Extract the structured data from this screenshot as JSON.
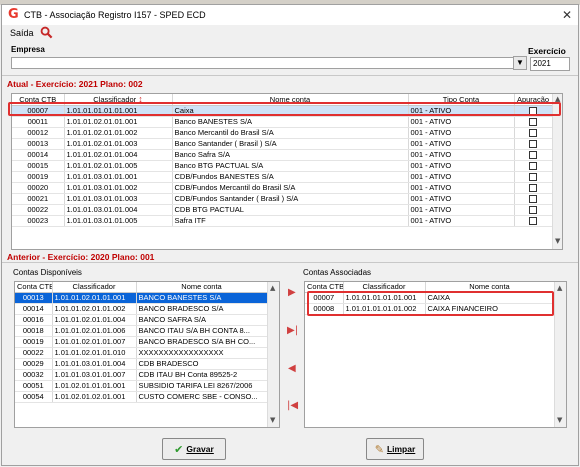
{
  "window": {
    "title": "CTB - Associação Registro I157 - SPED ECD",
    "app_icon": "G"
  },
  "menu": {
    "saida": "Saída"
  },
  "filters": {
    "empresa_label": "Empresa",
    "empresa_value": "",
    "exercicio_label": "Exercício",
    "exercicio_value": "2021"
  },
  "atual": {
    "title": "Atual - Exercício: 2021 Plano: 002",
    "columns": [
      "Conta CTB",
      "Classificador",
      "Nome conta",
      "Tipo Conta",
      "Apuração"
    ],
    "rows": [
      [
        "00007",
        "1.01.01.01.01.01.001",
        "Caixa",
        "001 - ATIVO"
      ],
      [
        "00011",
        "1.01.01.02.01.01.001",
        "Banco BANESTES S/A",
        "001 - ATIVO"
      ],
      [
        "00012",
        "1.01.01.02.01.01.002",
        "Banco Mercantil do Brasil S/A",
        "001 - ATIVO"
      ],
      [
        "00013",
        "1.01.01.02.01.01.003",
        "Banco Santander ( Brasil ) S/A",
        "001 - ATIVO"
      ],
      [
        "00014",
        "1.01.01.02.01.01.004",
        "Banco Safra S/A",
        "001 - ATIVO"
      ],
      [
        "00015",
        "1.01.01.02.01.01.005",
        "Banco BTG PACTUAL S/A",
        "001 - ATIVO"
      ],
      [
        "00019",
        "1.01.01.03.01.01.001",
        "CDB/Fundos BANESTES S/A",
        "001 - ATIVO"
      ],
      [
        "00020",
        "1.01.01.03.01.01.002",
        "CDB/Fundos Mercantil do Brasil S/A",
        "001 - ATIVO"
      ],
      [
        "00021",
        "1.01.01.03.01.01.003",
        "CDB/Fundos Santander ( Brasil ) S/A",
        "001 - ATIVO"
      ],
      [
        "00022",
        "1.01.01.03.01.01.004",
        "CDB BTG PACTUAL",
        "001 - ATIVO"
      ],
      [
        "00023",
        "1.01.01.03.01.01.005",
        "Safra ITF",
        "001 - ATIVO"
      ]
    ]
  },
  "anterior": {
    "title": "Anterior - Exercício: 2020 Plano: 001",
    "disponiveis_label": "Contas Disponíveis",
    "associadas_label": "Contas Associadas",
    "columns": [
      "Conta CTB",
      "Classificador",
      "Nome conta"
    ],
    "disponiveis": [
      [
        "00013",
        "1.01.01.02.01.01.001",
        "BANCO BANESTES S/A"
      ],
      [
        "00014",
        "1.01.01.02.01.01.002",
        "BANCO BRADESCO S/A"
      ],
      [
        "00016",
        "1.01.01.02.01.01.004",
        "BANCO SAFRA S/A"
      ],
      [
        "00018",
        "1.01.01.02.01.01.006",
        "BANCO ITAU S/A BH CONTA 8..."
      ],
      [
        "00019",
        "1.01.01.02.01.01.007",
        "BANCO BRADESCO S/A BH CO..."
      ],
      [
        "00022",
        "1.01.01.02.01.01.010",
        "XXXXXXXXXXXXXXXXX"
      ],
      [
        "00029",
        "1.01.01.03.01.01.004",
        "CDB BRADESCO"
      ],
      [
        "00032",
        "1.01.01.03.01.01.007",
        "CDB ITAU BH Conta 89525-2"
      ],
      [
        "00051",
        "1.01.02.01.01.01.001",
        "SUBSIDIO TARIFA LEI 8267/2006"
      ],
      [
        "00054",
        "1.01.02.01.02.01.001",
        "CUSTO COMERC SBE - CONSO..."
      ]
    ],
    "associadas": [
      [
        "00007",
        "1.01.01.01.01.01.001",
        "CAIXA"
      ],
      [
        "00008",
        "1.01.01.01.01.01.002",
        "CAIXA FINANCEIRO"
      ]
    ]
  },
  "buttons": {
    "gravar": "Gravar",
    "limpar": "Limpar"
  },
  "colors": {
    "section_title": "#c00000",
    "highlight_border": "#e03030",
    "selection": "#0a64d8"
  }
}
